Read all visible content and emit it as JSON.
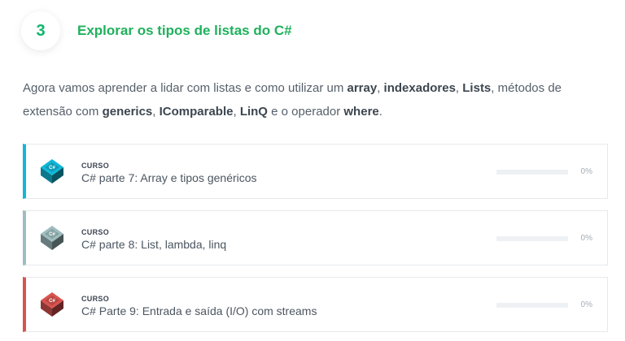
{
  "step": {
    "number": "3",
    "title": "Explorar os tipos de listas do C#"
  },
  "intro": {
    "t1": "Agora vamos aprender a lidar com listas e como utilizar um ",
    "b1": "array",
    "t2": ", ",
    "b2": "indexadores",
    "t3": ", ",
    "b3": "Lists",
    "t4": ", métodos de extensão com ",
    "b4": "generics",
    "t5": ", ",
    "b5": "IComparable",
    "t6": ", ",
    "b6": "LinQ",
    "t7": " e o operador ",
    "b7": "where",
    "t8": "."
  },
  "courses": [
    {
      "kind": "CURSO",
      "name": "C# parte 7: Array e tipos genéricos",
      "progress_label": "0%",
      "progress": 0,
      "accent": "#11b8d8",
      "icon": "csharp-book-icon"
    },
    {
      "kind": "CURSO",
      "name": "C# parte 8: List, lambda, linq",
      "progress_label": "0%",
      "progress": 0,
      "accent": "#9ebdbf",
      "icon": "csharp-book-icon"
    },
    {
      "kind": "CURSO",
      "name": "C# Parte 9: Entrada e saída (I/O) com streams",
      "progress_label": "0%",
      "progress": 0,
      "accent": "#d9534f",
      "icon": "csharp-book-icon"
    }
  ]
}
